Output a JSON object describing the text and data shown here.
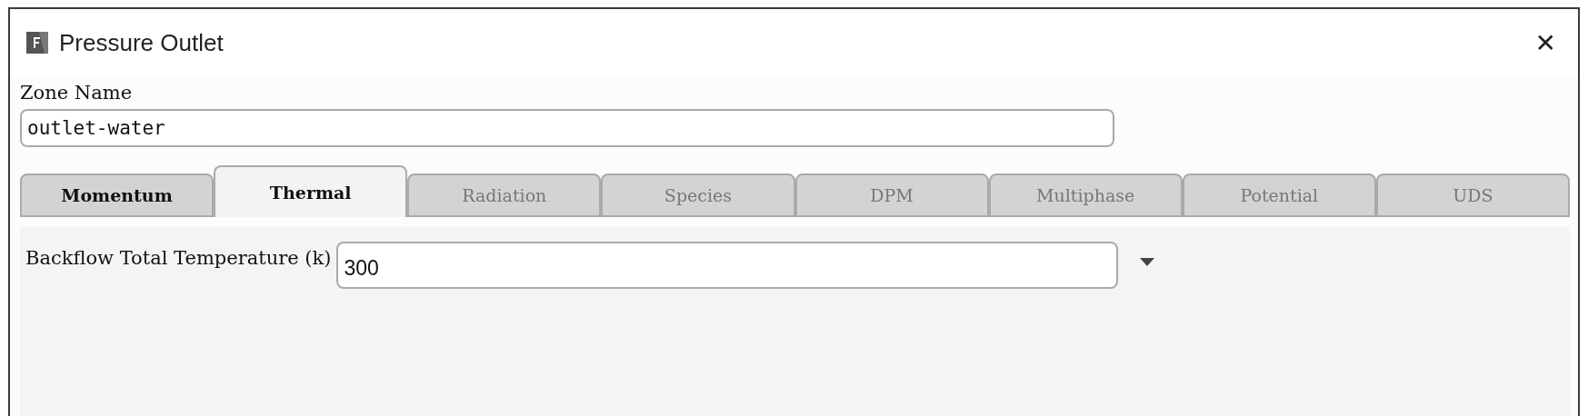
{
  "window": {
    "title": "Pressure Outlet",
    "close": "✕"
  },
  "zone_name": {
    "label": "Zone Name",
    "value": "outlet-water"
  },
  "tabs": [
    {
      "label": "Momentum",
      "selected": false,
      "disabled": false
    },
    {
      "label": "Thermal",
      "selected": true,
      "disabled": false
    },
    {
      "label": "Radiation",
      "selected": false,
      "disabled": true
    },
    {
      "label": "Species",
      "selected": false,
      "disabled": true
    },
    {
      "label": "DPM",
      "selected": false,
      "disabled": true
    },
    {
      "label": "Multiphase",
      "selected": false,
      "disabled": true
    },
    {
      "label": "Potential",
      "selected": false,
      "disabled": true
    },
    {
      "label": "UDS",
      "selected": false,
      "disabled": true
    }
  ],
  "fields": [
    {
      "label": "Backflow Total Temperature (k)",
      "value": "300"
    }
  ]
}
